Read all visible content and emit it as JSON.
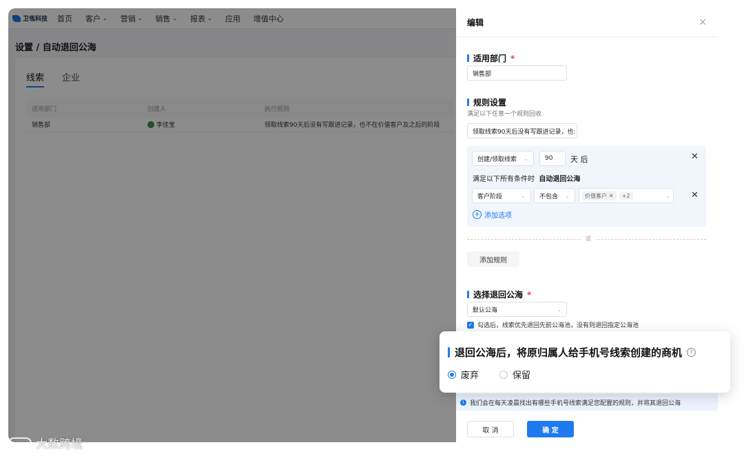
{
  "app": {
    "logo_text": "卫瓴科技",
    "nav": [
      {
        "label": "首页",
        "has_caret": false
      },
      {
        "label": "客户",
        "has_caret": true
      },
      {
        "label": "营销",
        "has_caret": true
      },
      {
        "label": "销售",
        "has_caret": true
      },
      {
        "label": "报表",
        "has_caret": true
      },
      {
        "label": "应用",
        "has_caret": false
      },
      {
        "label": "增值中心",
        "has_caret": false
      }
    ],
    "breadcrumb": "设置 / 自动退回公海",
    "tabs": [
      {
        "label": "线索",
        "active": true
      },
      {
        "label": "企业",
        "active": false
      }
    ],
    "table": {
      "headers": [
        "适用部门",
        "创建人",
        "执行规则"
      ],
      "rows": [
        [
          "销售部",
          "李佳宝",
          "领取线索90天后没有写跟进记录，也不在价值客户及之后的阶段"
        ]
      ]
    }
  },
  "drawer": {
    "title": "编辑",
    "dept_label": "适用部门",
    "dept_value": "销售部",
    "rule_label": "规则设置",
    "rule_note": "满足以下任意一个规则回收",
    "rule_summary": "领取线索90天后没有写跟进记录，也:",
    "rule": {
      "trigger": "创建/领取线索",
      "days": "90",
      "days_unit": "天 后",
      "cond_prefix": "满足以下所有条件时",
      "cond_action": "自动退回公海",
      "field": "客户阶段",
      "operator": "不包含",
      "tag": "价值客户",
      "more": "+2"
    },
    "add_option": "添加选项",
    "or_label": "或",
    "add_rule": "添加规则",
    "pool_label": "选择退回公海",
    "pool_value": "默认公海",
    "pool_check_text": "勾选后，线索优先退回先前公海池，没有则退回指定公海池",
    "info_text": "我们会在每天凌晨找出有哪些手机号线索满足您配置的规则，并将其退回公海",
    "cancel": "取 消",
    "ok": "确 定"
  },
  "callout": {
    "title": "退回公海后，将原归属人给手机号线索创建的商机",
    "options": [
      {
        "label": "废弃",
        "selected": true
      },
      {
        "label": "保留",
        "selected": false
      }
    ]
  },
  "watermark": "大数跨境"
}
